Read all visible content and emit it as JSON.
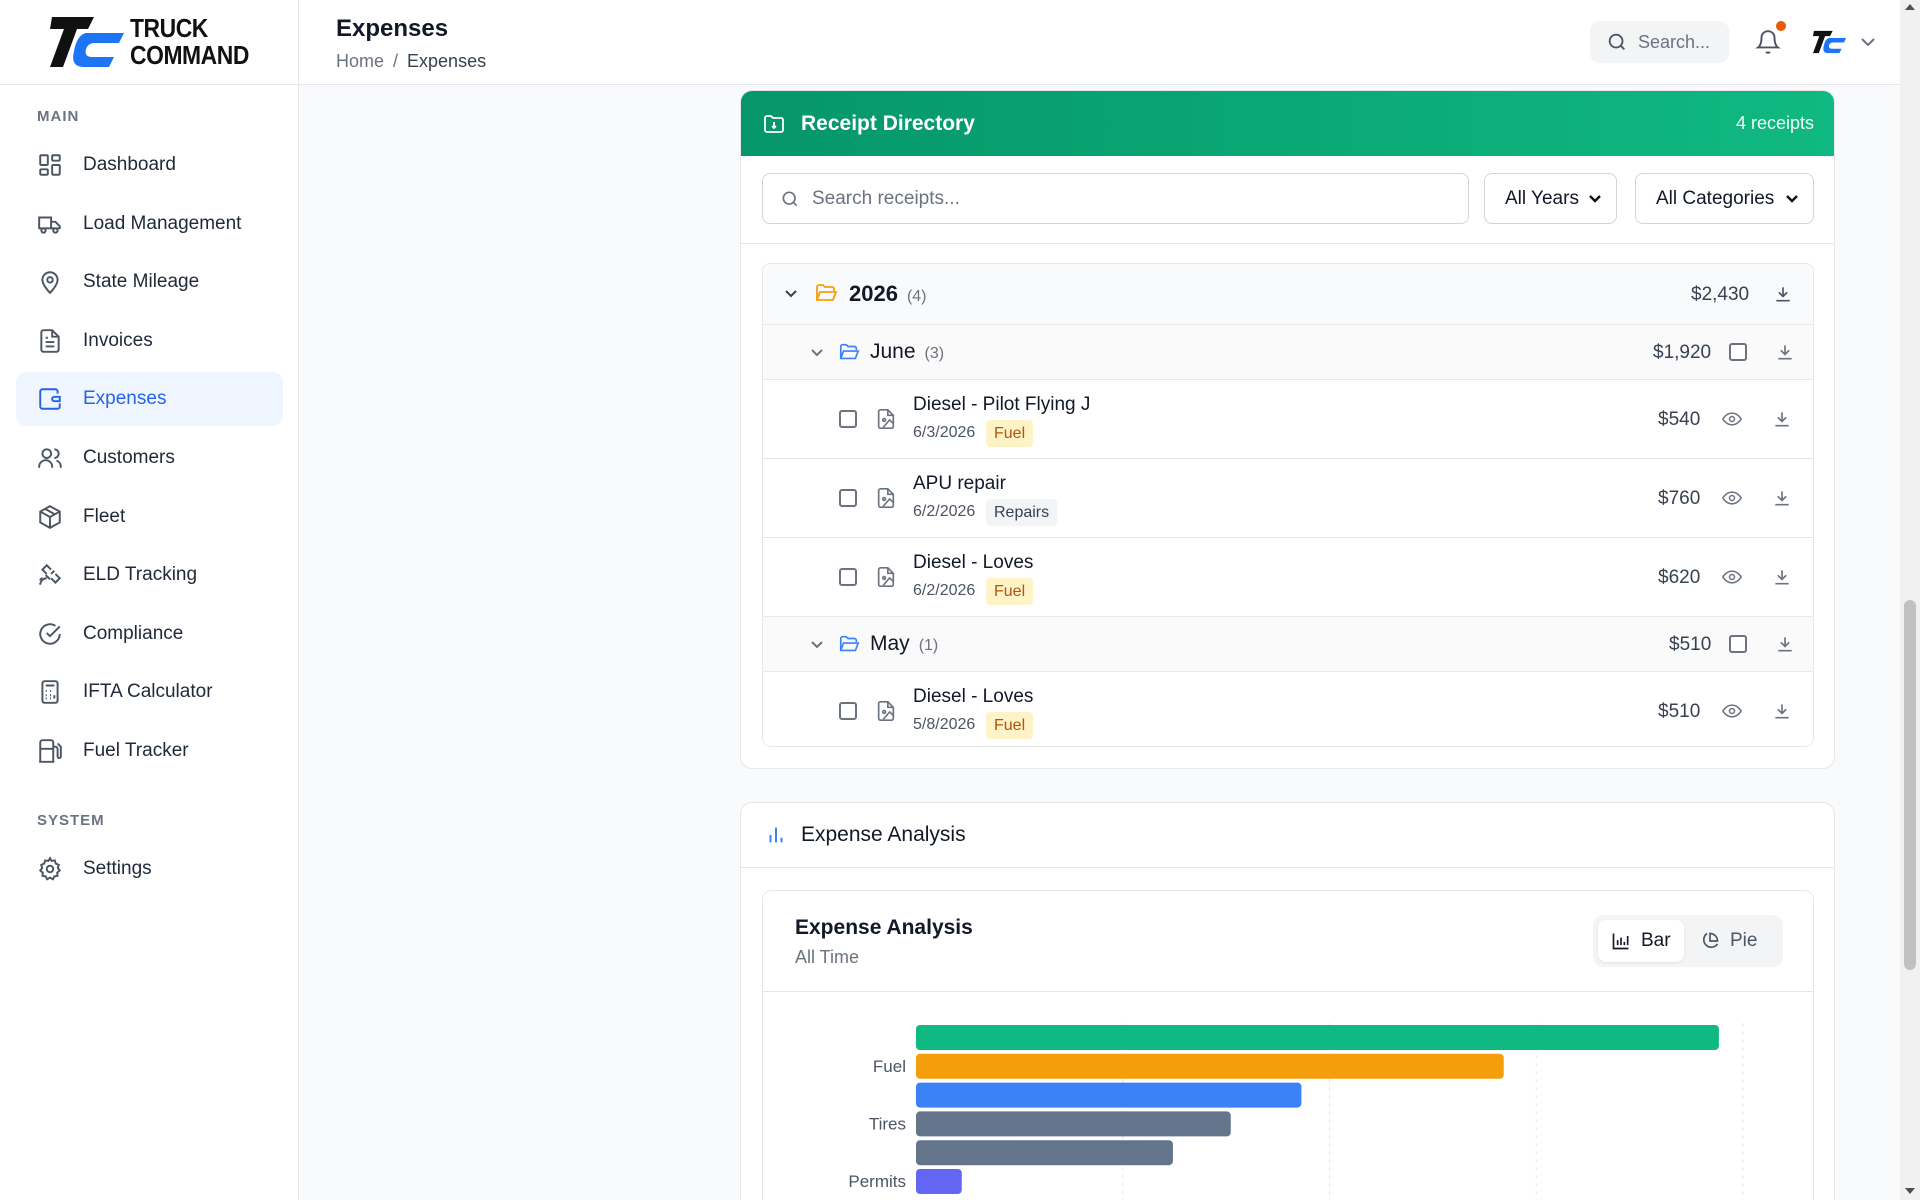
{
  "app": {
    "brand_line1": "TRUCK",
    "brand_line2": "COMMAND"
  },
  "sidebar": {
    "sections": [
      {
        "label": "MAIN",
        "items": [
          {
            "label": "Dashboard",
            "icon": "dashboard-icon"
          },
          {
            "label": "Load Management",
            "icon": "truck-icon"
          },
          {
            "label": "State Mileage",
            "icon": "map-pin-icon"
          },
          {
            "label": "Invoices",
            "icon": "file-text-icon"
          },
          {
            "label": "Expenses",
            "icon": "wallet-icon",
            "active": true
          },
          {
            "label": "Customers",
            "icon": "users-icon"
          },
          {
            "label": "Fleet",
            "icon": "package-icon"
          },
          {
            "label": "ELD Tracking",
            "icon": "satellite-icon"
          },
          {
            "label": "Compliance",
            "icon": "check-circle-icon"
          },
          {
            "label": "IFTA Calculator",
            "icon": "calculator-icon"
          },
          {
            "label": "Fuel Tracker",
            "icon": "fuel-icon"
          }
        ]
      },
      {
        "label": "SYSTEM",
        "items": [
          {
            "label": "Settings",
            "icon": "gear-icon"
          }
        ]
      }
    ]
  },
  "header": {
    "title": "Expenses",
    "breadcrumb": [
      "Home",
      "/",
      "Expenses"
    ],
    "search_placeholder": "Search..."
  },
  "receipts": {
    "title": "Receipt Directory",
    "count_label": "4 receipts",
    "search_placeholder": "Search receipts...",
    "year_filter": "All Years",
    "category_filter": "All Categories",
    "year": {
      "label": "2026",
      "count": "(4)",
      "total": "$2,430"
    },
    "months": [
      {
        "label": "June",
        "count": "(3)",
        "total": "$1,920",
        "items": [
          {
            "name": "Diesel - Pilot Flying J",
            "date": "6/3/2026",
            "tag": "Fuel",
            "amount": "$540"
          },
          {
            "name": "APU repair",
            "date": "6/2/2026",
            "tag": "Repairs",
            "amount": "$760"
          },
          {
            "name": "Diesel - Loves",
            "date": "6/2/2026",
            "tag": "Fuel",
            "amount": "$620"
          }
        ]
      },
      {
        "label": "May",
        "count": "(1)",
        "total": "$510",
        "items": [
          {
            "name": "Diesel - Loves",
            "date": "5/8/2026",
            "tag": "Fuel",
            "amount": "$510"
          }
        ]
      }
    ]
  },
  "analysis": {
    "section_title": "Expense Analysis",
    "title": "Expense Analysis",
    "subtitle": "All Time",
    "toggle": {
      "bar": "Bar",
      "pie": "Pie",
      "selected": "Bar"
    }
  },
  "chart_data": {
    "type": "bar",
    "orientation": "horizontal",
    "tick_labels_visible": [
      "Fuel",
      "Tires",
      "Permits"
    ],
    "bars": [
      {
        "value": 1000,
        "color": "#10b981",
        "label": ""
      },
      {
        "value": 732,
        "color": "#f59e0b",
        "label": "Fuel"
      },
      {
        "value": 480,
        "color": "#3b82f6",
        "label": ""
      },
      {
        "value": 392,
        "color": "#64748b",
        "label": "Tires"
      },
      {
        "value": 320,
        "color": "#64748b",
        "label": ""
      },
      {
        "value": 57,
        "color": "#6366f1",
        "label": "Permits"
      }
    ],
    "xlim": [
      0,
      1030
    ],
    "grid": "vertical-dashed"
  }
}
